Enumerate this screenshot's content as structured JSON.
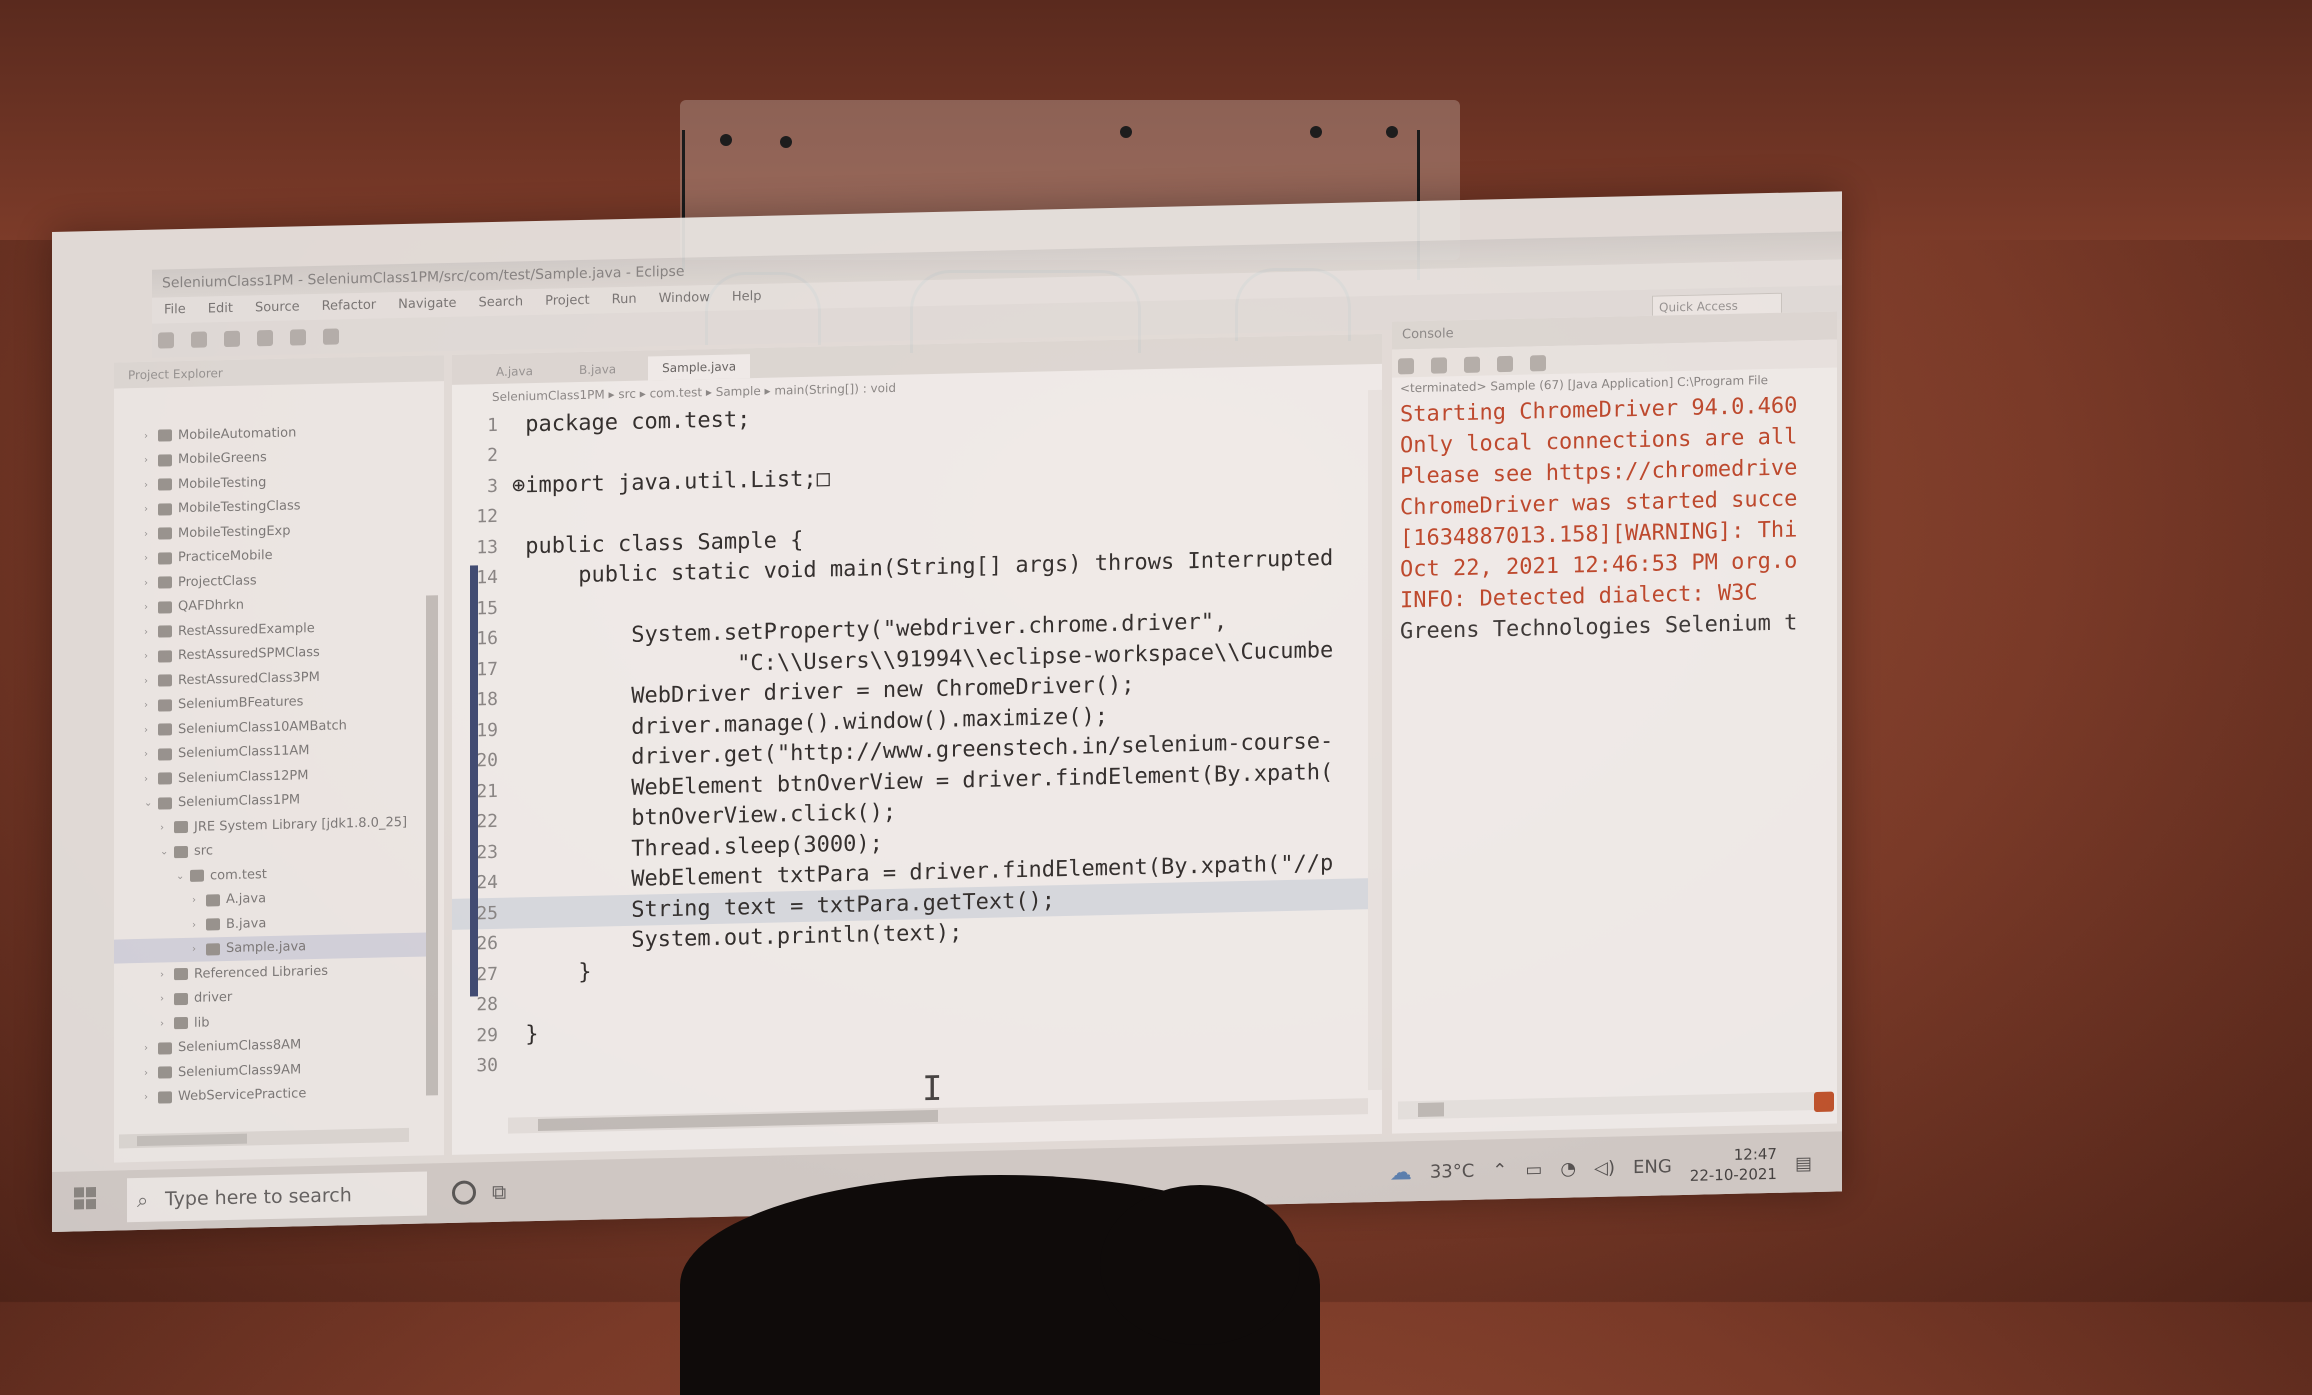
{
  "window": {
    "title": "SeleniumClass1PM - SeleniumClass1PM/src/com/test/Sample.java - Eclipse",
    "menu": [
      "File",
      "Edit",
      "Source",
      "Refactor",
      "Navigate",
      "Search",
      "Project",
      "Run",
      "Window",
      "Help"
    ],
    "quick_access_placeholder": "Quick Access"
  },
  "explorer": {
    "tab_label": "Project Explorer",
    "items": [
      {
        "label": "MobileAutomation",
        "indent": 0,
        "expanded": false
      },
      {
        "label": "MobileGreens",
        "indent": 0,
        "expanded": false
      },
      {
        "label": "MobileTesting",
        "indent": 0,
        "expanded": false
      },
      {
        "label": "MobileTestingClass",
        "indent": 0,
        "expanded": false
      },
      {
        "label": "MobileTestingExp",
        "indent": 0,
        "expanded": false
      },
      {
        "label": "PracticeMobile",
        "indent": 0,
        "expanded": false
      },
      {
        "label": "ProjectClass",
        "indent": 0,
        "expanded": false
      },
      {
        "label": "QAFDhrkn",
        "indent": 0,
        "expanded": false
      },
      {
        "label": "RestAssuredExample",
        "indent": 0,
        "expanded": false
      },
      {
        "label": "RestAssuredSPMClass",
        "indent": 0,
        "expanded": false
      },
      {
        "label": "RestAssuredClass3PM",
        "indent": 0,
        "expanded": false
      },
      {
        "label": "SeleniumBFeatures",
        "indent": 0,
        "expanded": false
      },
      {
        "label": "SeleniumClass10AMBatch",
        "indent": 0,
        "expanded": false
      },
      {
        "label": "SeleniumClass11AM",
        "indent": 0,
        "expanded": false
      },
      {
        "label": "SeleniumClass12PM",
        "indent": 0,
        "expanded": false
      },
      {
        "label": "SeleniumClass1PM",
        "indent": 0,
        "expanded": true
      },
      {
        "label": "JRE System Library [jdk1.8.0_25]",
        "indent": 1,
        "expanded": false
      },
      {
        "label": "src",
        "indent": 1,
        "expanded": true
      },
      {
        "label": "com.test",
        "indent": 2,
        "expanded": true
      },
      {
        "label": "A.java",
        "indent": 3,
        "expanded": false
      },
      {
        "label": "B.java",
        "indent": 3,
        "expanded": false
      },
      {
        "label": "Sample.java",
        "indent": 3,
        "expanded": false,
        "selected": true
      },
      {
        "label": "Referenced Libraries",
        "indent": 1,
        "expanded": false
      },
      {
        "label": "driver",
        "indent": 1,
        "expanded": false
      },
      {
        "label": "lib",
        "indent": 1,
        "expanded": false
      },
      {
        "label": "SeleniumClass8AM",
        "indent": 0,
        "expanded": false
      },
      {
        "label": "SeleniumClass9AM",
        "indent": 0,
        "expanded": false
      },
      {
        "label": "WebServicePractice",
        "indent": 0,
        "expanded": false
      }
    ]
  },
  "editor": {
    "tabs": [
      "A.java",
      "B.java",
      "Sample.java"
    ],
    "breadcrumb": "SeleniumClass1PM ▸ src ▸ com.test ▸ Sample ▸ main(String[]) : void",
    "current_line": "25",
    "lines": [
      {
        "n": "1",
        "text": " package com.test;"
      },
      {
        "n": "2",
        "text": ""
      },
      {
        "n": "3",
        "text": "⊕import java.util.List;□"
      },
      {
        "n": "12",
        "text": ""
      },
      {
        "n": "13",
        "text": " public class Sample {"
      },
      {
        "n": "14",
        "text": "     public static void main(String[] args) throws Interrupted",
        "mark": true
      },
      {
        "n": "15",
        "text": "",
        "mark": true
      },
      {
        "n": "16",
        "text": "         System.setProperty(\"webdriver.chrome.driver\",",
        "mark": true
      },
      {
        "n": "17",
        "text": "                 \"C:\\\\Users\\\\91994\\\\eclipse-workspace\\\\Cucumbe",
        "mark": true
      },
      {
        "n": "18",
        "text": "         WebDriver driver = new ChromeDriver();",
        "mark": true
      },
      {
        "n": "19",
        "text": "         driver.manage().window().maximize();",
        "mark": true
      },
      {
        "n": "20",
        "text": "         driver.get(\"http://www.greenstech.in/selenium-course-",
        "mark": true
      },
      {
        "n": "21",
        "text": "         WebElement btnOverView = driver.findElement(By.xpath(",
        "mark": true
      },
      {
        "n": "22",
        "text": "         btnOverView.click();",
        "mark": true
      },
      {
        "n": "23",
        "text": "         Thread.sleep(3000);",
        "mark": true
      },
      {
        "n": "24",
        "text": "         WebElement txtPara = driver.findElement(By.xpath(\"//p",
        "mark": true
      },
      {
        "n": "25",
        "text": "         String text = txtPara.getText();",
        "mark": true
      },
      {
        "n": "26",
        "text": "         System.out.println(text);",
        "mark": true
      },
      {
        "n": "27",
        "text": "     }",
        "mark": true
      },
      {
        "n": "28",
        "text": ""
      },
      {
        "n": "29",
        "text": " }"
      },
      {
        "n": "30",
        "text": ""
      }
    ]
  },
  "console": {
    "tab_label": "Console",
    "terminated": "<terminated> Sample (67) [Java Application] C:\\Program File",
    "lines": [
      {
        "text": "Starting ChromeDriver 94.0.460",
        "kind": "err"
      },
      {
        "text": "Only local connections are all",
        "kind": "err"
      },
      {
        "text": "Please see https://chromedrive",
        "kind": "err"
      },
      {
        "text": "ChromeDriver was started succe",
        "kind": "err"
      },
      {
        "text": "[1634887013.158][WARNING]: Thi",
        "kind": "err"
      },
      {
        "text": "Oct 22, 2021 12:46:53 PM org.o",
        "kind": "err"
      },
      {
        "text": "INFO: Detected dialect: W3C",
        "kind": "err"
      },
      {
        "text": "Greens Technologies Selenium t",
        "kind": "out"
      }
    ]
  },
  "taskbar": {
    "search_placeholder": "Type here to search",
    "weather": "33°C",
    "language": "ENG",
    "time": "12:47",
    "date": "22-10-2021"
  },
  "colors": {
    "console_error": "#c24a2e",
    "keyword": "#6a1a4a",
    "string": "#1e3aa8",
    "current_line_bg": "#dde3ea",
    "wall": "#8a452f"
  }
}
